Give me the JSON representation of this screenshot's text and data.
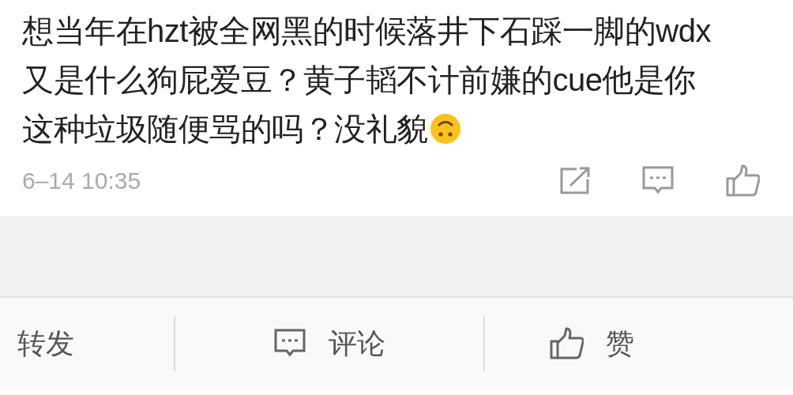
{
  "comment": {
    "text": "想当年在hzt被全网黑的时候落井下石踩一脚的wdx 又是什么狗屁爱豆？黄子韬不计前嫌的cue他是你这种垃圾随便骂的吗？没礼貌",
    "time": "6–14 10:35"
  },
  "action_bar": [
    {
      "kind": "repost",
      "label": "转发"
    },
    {
      "kind": "comment",
      "label": "评论"
    },
    {
      "kind": "like",
      "label": "赞"
    }
  ]
}
